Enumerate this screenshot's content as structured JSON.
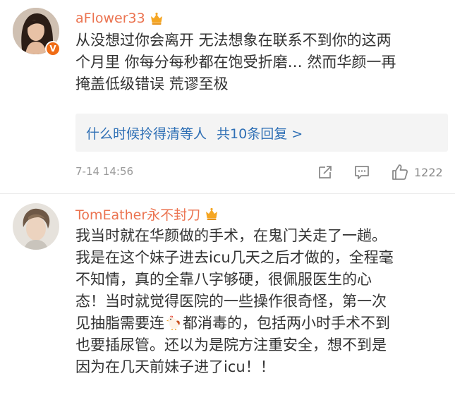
{
  "comments": [
    {
      "username": "aFlower33",
      "text_lines": [
        "从没想过你会离开  无法想象在联系不到你的这两",
        "个月里  你每分每秒都在饱受折磨…  然而华颜一再",
        "掩盖低级错误  荒谬至极"
      ],
      "reply_preview": {
        "user": "什么时候拎得清等人",
        "summary": "共10条回复 >"
      },
      "timestamp": "7-14 14:56",
      "likes": "1222"
    },
    {
      "username": "TomEather永不封刀",
      "text_lines": [
        "我当时就在华颜做的手术，在鬼门关走了一趟。",
        "我是在这个妹子进去icu几天之后才做的，全程毫",
        "不知情，真的全靠八字够硬，很佩服医生的心",
        "态！当时就觉得医院的一些操作很奇怪，第一次"
      ],
      "line5_before": "见抽脂需要连",
      "line5_after": "都消毒的，包括两小时手术不到",
      "text_lines_end": [
        "也要插尿管。还以为是院方注重安全，想不到是",
        "因为在几天前妹子进了icu！！"
      ]
    }
  ],
  "colors": {
    "username": "#eb7350",
    "link": "#2e6fb5",
    "body_text": "#333333",
    "meta_text": "#999999",
    "reply_bg": "#f4f4f4",
    "verify_badge": "#f06c16",
    "vip_crown": "#f5a623"
  },
  "icons": {
    "verified": "verified-v-badge",
    "vip": "vip-crown-icon",
    "share": "share-icon",
    "reply": "comment-icon",
    "like": "thumbs-up-icon",
    "emoji": "chicken-emoji"
  }
}
